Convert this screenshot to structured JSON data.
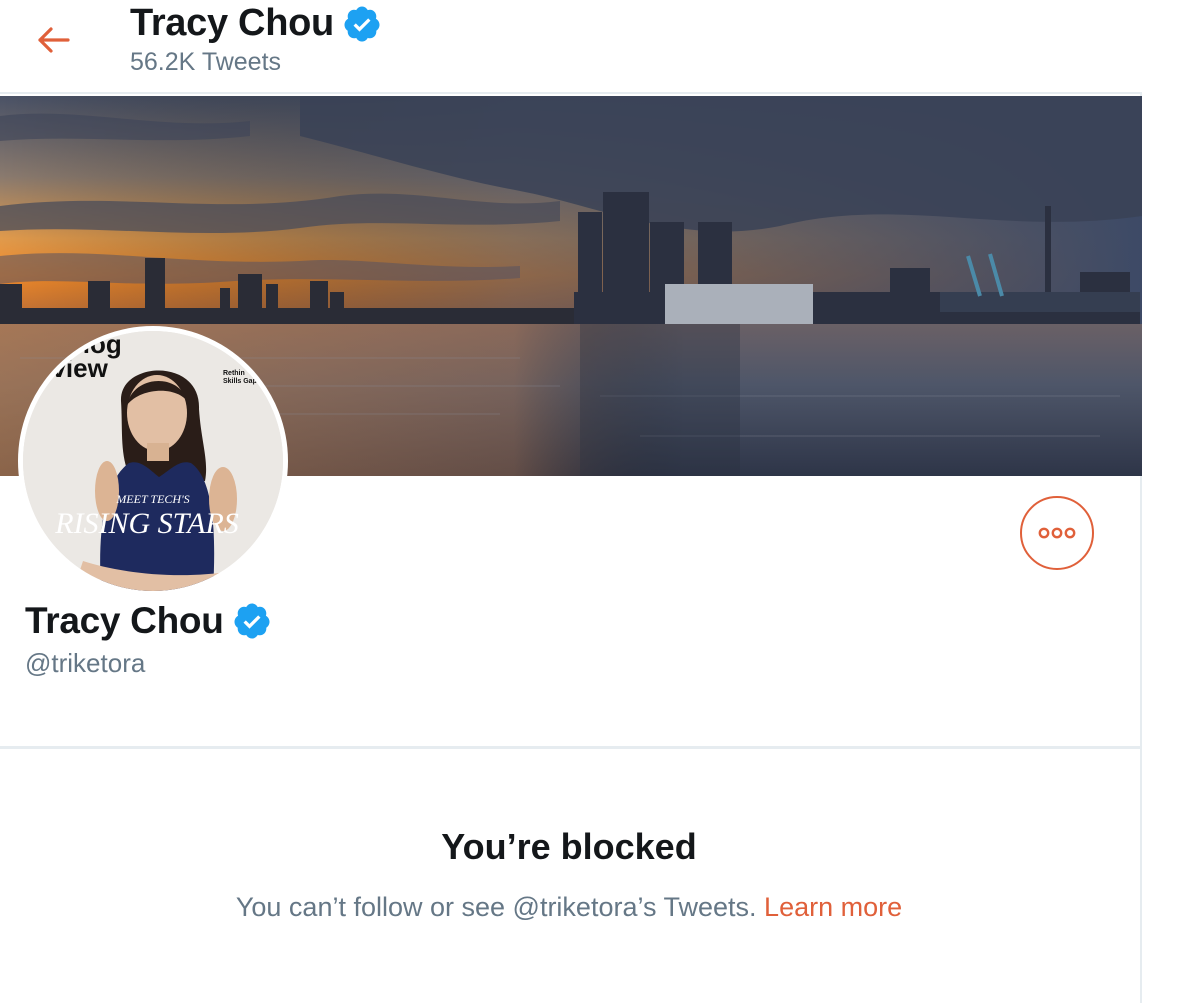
{
  "header": {
    "name": "Tracy Chou",
    "tweet_count": "56.2K Tweets",
    "back_icon": "arrow-left-icon"
  },
  "profile": {
    "name": "Tracy Chou",
    "handle": "@triketora",
    "verified": true,
    "avatar_text": {
      "line1": "nolog",
      "line2": "eview",
      "side1": "Rethin",
      "side2": "Skills Gap",
      "cover_small": "MEET TECH'S",
      "cover_big": "RISING STARS"
    }
  },
  "blocked": {
    "title": "You’re blocked",
    "message": "You can’t follow or see @triketora’s Tweets.",
    "link": "Learn more"
  },
  "colors": {
    "accent": "#e0603a",
    "verified": "#1da1f2",
    "secondary_text": "#657786",
    "border": "#e6ecf0"
  },
  "icons": [
    "arrow-left-icon",
    "verified-badge-icon",
    "more-icon"
  ]
}
